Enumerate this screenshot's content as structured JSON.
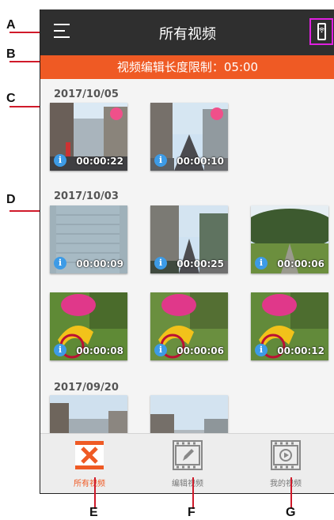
{
  "callouts": {
    "a": "A",
    "b": "B",
    "c": "C",
    "d": "D",
    "e": "E",
    "f": "F",
    "g": "G"
  },
  "header": {
    "title": "所有视频",
    "menu_icon": "hamburger-icon",
    "wifi_icon": "phone-wifi-icon"
  },
  "limit_bar": {
    "text": "视频编辑长度限制：05:00"
  },
  "colors": {
    "accent": "#ef5a24",
    "topbar": "#2f2f2f",
    "info": "#3d9be6",
    "edit_mark": "#f0508a",
    "highlight": "#e020e0"
  },
  "groups": [
    {
      "date": "2017/10/05",
      "videos": [
        {
          "duration": "00:00:22",
          "edited": true
        },
        {
          "duration": "00:00:10",
          "edited": true
        }
      ]
    },
    {
      "date": "2017/10/03",
      "videos": [
        {
          "duration": "00:00:09"
        },
        {
          "duration": "00:00:25"
        },
        {
          "duration": "00:00:06"
        },
        {
          "duration": "00:00:08"
        },
        {
          "duration": "00:00:06"
        },
        {
          "duration": "00:00:12"
        }
      ]
    },
    {
      "date": "2017/09/20",
      "videos": []
    }
  ],
  "tabs": [
    {
      "label": "所有视频",
      "icon": "film-x-icon",
      "active": true
    },
    {
      "label": "编辑视频",
      "icon": "film-edit-icon",
      "active": false
    },
    {
      "label": "我的视频",
      "icon": "film-play-icon",
      "active": false
    }
  ]
}
